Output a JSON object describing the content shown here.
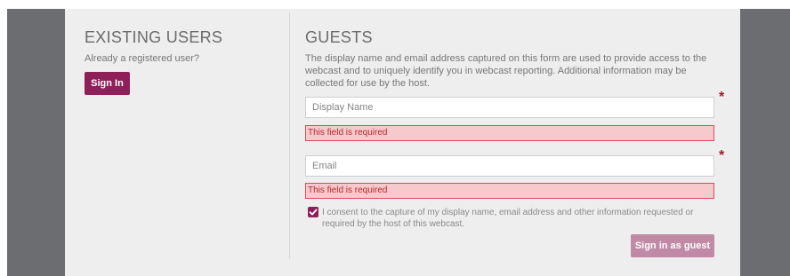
{
  "existing": {
    "heading": "EXISTING USERS",
    "subtext": "Already a registered user?",
    "sign_in_label": "Sign In"
  },
  "guests": {
    "heading": "GUESTS",
    "description": "The display name and email address captured on this form are used to provide access to the webcast and to uniquely identify you in webcast reporting. Additional information may be collected for use by the host.",
    "display_name_placeholder": "Display Name",
    "email_placeholder": "Email",
    "required_marker": "*",
    "error_text": "This field is required",
    "consent_text": "I consent to the capture of my display name, email address and other information requested or required by the host of this webcast.",
    "consent_checked": true,
    "submit_label": "Sign in as guest"
  },
  "colors": {
    "brand": "#8f1f58",
    "brand_disabled": "#c08aa5",
    "error_bg": "#f6c9cc",
    "error_border": "#d94e5c",
    "side_bar": "#6b6d70",
    "panel_bg": "#eeeeee"
  },
  "icons": {
    "consent_checkbox": "checkmark-icon"
  }
}
